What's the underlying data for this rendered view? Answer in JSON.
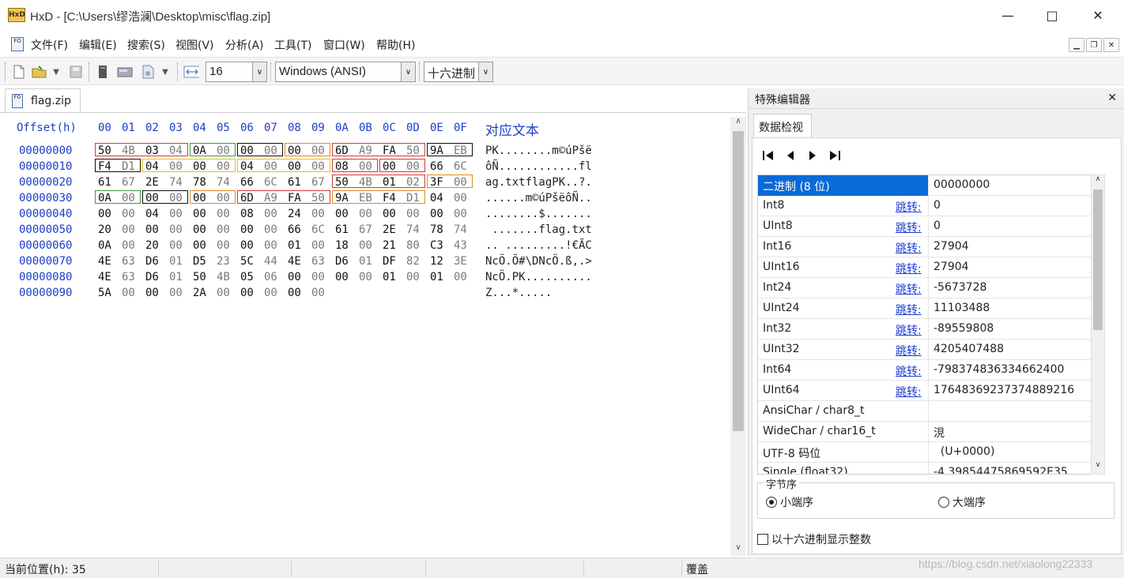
{
  "window": {
    "app_logo": "HxD",
    "title": "HxD - [C:\\Users\\缪浩澜\\Desktop\\misc\\flag.zip]",
    "minimize_icon": "minimize-icon",
    "maximize_icon": "maximize-icon",
    "close_icon": "close-icon"
  },
  "menu": {
    "items": [
      "文件(F)",
      "编辑(E)",
      "搜索(S)",
      "视图(V)",
      "分析(A)",
      "工具(T)",
      "窗口(W)",
      "帮助(H)"
    ],
    "doc_icon": "FO"
  },
  "toolbar": {
    "bytes_per_row": "16",
    "charset": "Windows (ANSI)",
    "offset_base": "十六进制"
  },
  "document_tab": {
    "label": "flag.zip",
    "icon_text": "FO"
  },
  "hex_view": {
    "offset_header": "Offset(h)",
    "column_headers": [
      "00",
      "01",
      "02",
      "03",
      "04",
      "05",
      "06",
      "07",
      "08",
      "09",
      "0A",
      "0B",
      "0C",
      "0D",
      "0E",
      "0F"
    ],
    "text_header": "对应文本",
    "rows": [
      {
        "offset": "00000000",
        "bytes": [
          "50",
          "4B",
          "03",
          "04",
          "0A",
          "00",
          "00",
          "00",
          "00",
          "00",
          "6D",
          "A9",
          "FA",
          "50",
          "9A",
          "EB"
        ],
        "text": "PK........m©úPšë"
      },
      {
        "offset": "00000010",
        "bytes": [
          "F4",
          "D1",
          "04",
          "00",
          "00",
          "00",
          "04",
          "00",
          "00",
          "00",
          "08",
          "00",
          "00",
          "00",
          "66",
          "6C"
        ],
        "text": "ôÑ............fl"
      },
      {
        "offset": "00000020",
        "bytes": [
          "61",
          "67",
          "2E",
          "74",
          "78",
          "74",
          "66",
          "6C",
          "61",
          "67",
          "50",
          "4B",
          "01",
          "02",
          "3F",
          "00"
        ],
        "text": "ag.txtflagPK..?."
      },
      {
        "offset": "00000030",
        "bytes": [
          "0A",
          "00",
          "00",
          "00",
          "00",
          "00",
          "6D",
          "A9",
          "FA",
          "50",
          "9A",
          "EB",
          "F4",
          "D1",
          "04",
          "00"
        ],
        "text": "......m©úPšëôÑ.."
      },
      {
        "offset": "00000040",
        "bytes": [
          "00",
          "00",
          "04",
          "00",
          "00",
          "00",
          "08",
          "00",
          "24",
          "00",
          "00",
          "00",
          "00",
          "00",
          "00",
          "00"
        ],
        "text": "........$......."
      },
      {
        "offset": "00000050",
        "bytes": [
          "20",
          "00",
          "00",
          "00",
          "00",
          "00",
          "00",
          "00",
          "66",
          "6C",
          "61",
          "67",
          "2E",
          "74",
          "78",
          "74"
        ],
        "text": " .......flag.txt"
      },
      {
        "offset": "00000060",
        "bytes": [
          "0A",
          "00",
          "20",
          "00",
          "00",
          "00",
          "00",
          "00",
          "01",
          "00",
          "18",
          "00",
          "21",
          "80",
          "C3",
          "43"
        ],
        "text": ".. .........!€ÃC"
      },
      {
        "offset": "00000070",
        "bytes": [
          "4E",
          "63",
          "D6",
          "01",
          "D5",
          "23",
          "5C",
          "44",
          "4E",
          "63",
          "D6",
          "01",
          "DF",
          "82",
          "12",
          "3E"
        ],
        "text": "NcÖ.Õ#\\DNcÖ.ß‚.>"
      },
      {
        "offset": "00000080",
        "bytes": [
          "4E",
          "63",
          "D6",
          "01",
          "50",
          "4B",
          "05",
          "06",
          "00",
          "00",
          "00",
          "00",
          "01",
          "00",
          "01",
          "00"
        ],
        "text": "NcÖ.PK.........."
      },
      {
        "offset": "00000090",
        "bytes": [
          "5A",
          "00",
          "00",
          "00",
          "2A",
          "00",
          "00",
          "00",
          "00",
          "00"
        ],
        "text": "Z...*....."
      }
    ]
  },
  "special_editor": {
    "title": "特殊编辑器",
    "close_icon": "close-icon",
    "tab": "数据检视",
    "nav_icons": [
      "first-icon",
      "prev-icon",
      "next-icon",
      "last-icon"
    ],
    "jump_label": "跳转:",
    "rows": [
      {
        "name": "二进制 (8 位)",
        "value": "00000000",
        "jump": false,
        "selected": true
      },
      {
        "name": "Int8",
        "value": "0",
        "jump": true
      },
      {
        "name": "UInt8",
        "value": "0",
        "jump": true
      },
      {
        "name": "Int16",
        "value": "27904",
        "jump": true
      },
      {
        "name": "UInt16",
        "value": "27904",
        "jump": true
      },
      {
        "name": "Int24",
        "value": "-5673728",
        "jump": true
      },
      {
        "name": "UInt24",
        "value": "11103488",
        "jump": true
      },
      {
        "name": "Int32",
        "value": "-89559808",
        "jump": true
      },
      {
        "name": "UInt32",
        "value": "4205407488",
        "jump": true
      },
      {
        "name": "Int64",
        "value": "-798374836334662400",
        "jump": true
      },
      {
        "name": "UInt64",
        "value": "17648369237374889216",
        "jump": true
      },
      {
        "name": "AnsiChar / char8_t",
        "value": "",
        "jump": false
      },
      {
        "name": "WideChar / char16_t",
        "value": "涀",
        "jump": false
      },
      {
        "name": "UTF-8 码位",
        "value": "  (U+0000)",
        "jump": false
      },
      {
        "name": "Single (float32)",
        "value": "-4.39854475869592E35",
        "jump": false
      }
    ],
    "byte_order": {
      "legend": "字节序",
      "little": "小端序",
      "big": "大端序",
      "selected": "little"
    },
    "hex_ints_label": "以十六进制显示整数"
  },
  "statusbar": {
    "position": "当前位置(h): 35",
    "mode": "覆盖",
    "watermark": "https://blog.csdn.net/xiaolong22333"
  }
}
